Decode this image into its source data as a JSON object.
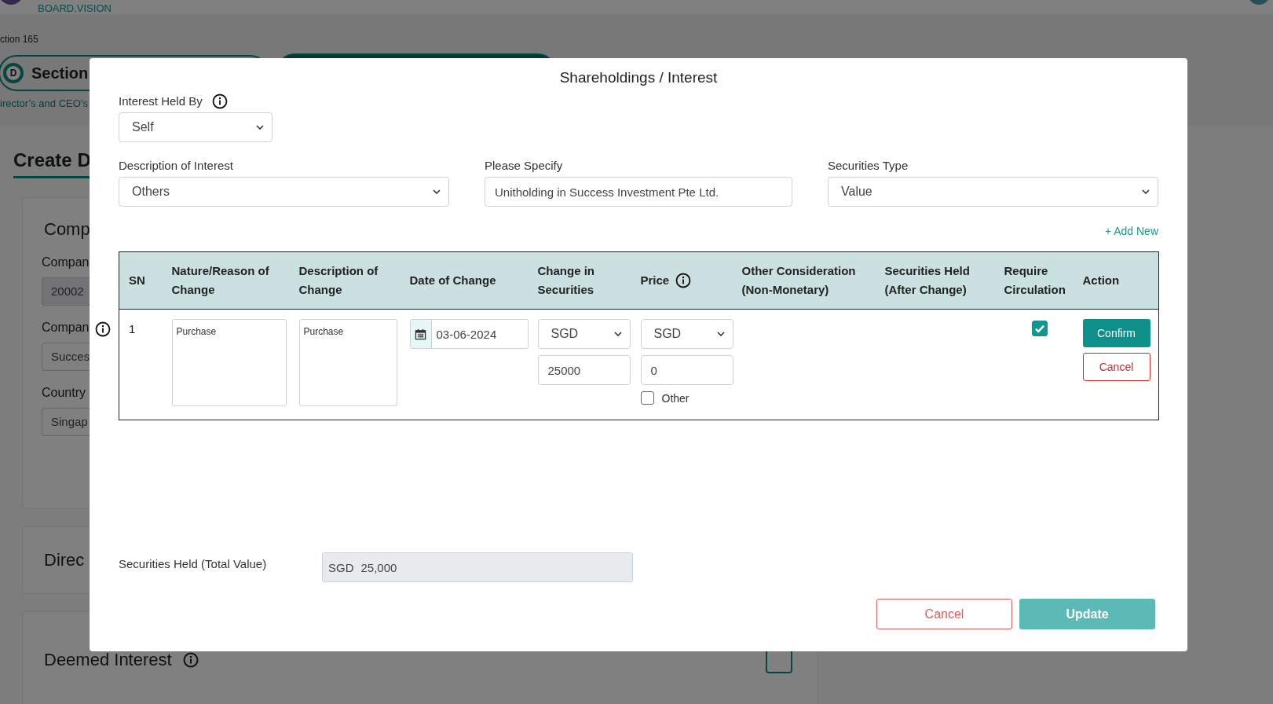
{
  "header": {
    "brand": "BOARD.VISION"
  },
  "breadcrumb": "ction 165",
  "section_tabs": [
    {
      "badge": "D",
      "label": "Section",
      "selected": false
    },
    {
      "selected": true
    }
  ],
  "section_subtitle": "irector’s and CEO’s",
  "page_title": "Create D",
  "cards": [
    {
      "kind": "form",
      "title": "Comp",
      "fields": [
        {
          "label": "Compan",
          "value": "20002",
          "disabled": true
        },
        {
          "label": "Compan",
          "value": "Succes",
          "disabled": false
        },
        {
          "label": "Country",
          "value": "Singap",
          "disabled": false
        }
      ]
    },
    {
      "kind": "plain",
      "title": "Direc"
    },
    {
      "kind": "add",
      "title": "Deemed Interest"
    }
  ],
  "modal": {
    "title": "Shareholdings / Interest",
    "interest_held_by": {
      "label": "Interest Held By",
      "value": "Self"
    },
    "fields": [
      {
        "label": "Description of Interest",
        "kind": "select",
        "value": "Others"
      },
      {
        "label": "Please Specify",
        "kind": "input",
        "value": "Unitholding in Success Investment Pte Ltd."
      },
      {
        "label": "Securities Type",
        "kind": "select",
        "value": "Value"
      }
    ],
    "add_new": "+ Add New",
    "table": {
      "columns": [
        {
          "label": "SN",
          "info": false
        },
        {
          "label": "Nature/Reason of Change",
          "info": false
        },
        {
          "label": "Description of Change",
          "info": false
        },
        {
          "label": "Date of Change",
          "info": false
        },
        {
          "label": "Change in Securities",
          "info": false
        },
        {
          "label": "Price",
          "info": true
        },
        {
          "label": "Other Consideration (Non-Monetary)",
          "info": false
        },
        {
          "label": "Securities Held (After Change)",
          "info": false
        },
        {
          "label": "Require Circulation",
          "info": false
        },
        {
          "label": "Action",
          "info": false
        }
      ],
      "rows": [
        {
          "sn": "1",
          "nature": "Purchase",
          "description": "Purchase",
          "date": "03-06-2024",
          "change_currency": "SGD",
          "change_amount": "25000",
          "price_currency": "SGD",
          "price_amount": "0",
          "other_checked": false,
          "other_label": "Other",
          "require_circulation": true,
          "confirm": "Confirm",
          "cancel": "Cancel"
        }
      ]
    },
    "total": {
      "label": "Securities Held (Total Value)",
      "currency": "SGD",
      "value": "25,000"
    },
    "buttons": [
      {
        "label": "Cancel",
        "kind": "secondary"
      },
      {
        "label": "Update",
        "kind": "primary"
      }
    ]
  }
}
